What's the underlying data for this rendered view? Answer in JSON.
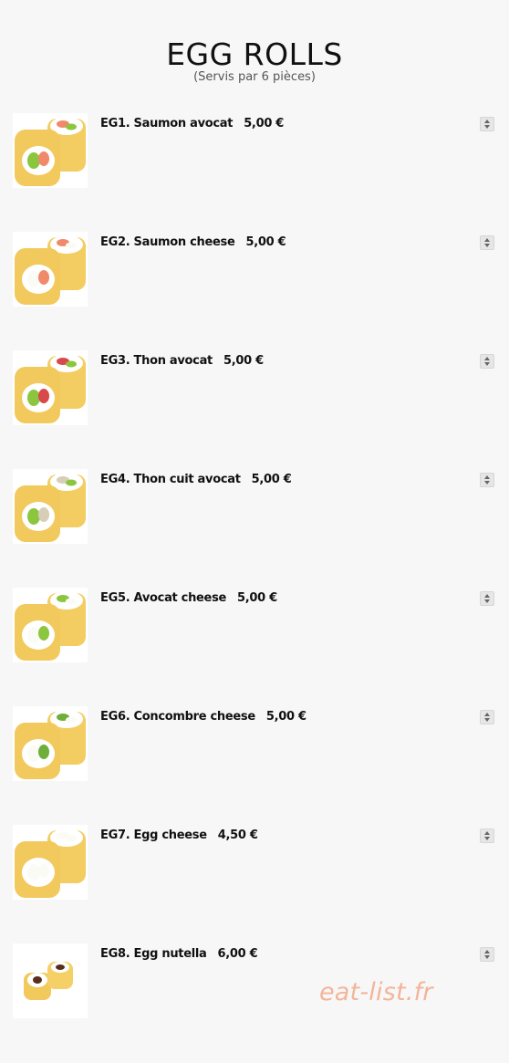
{
  "header": {
    "title": "EGG ROLLS",
    "subtitle": "(Servis par 6 pièces)"
  },
  "items": [
    {
      "label": "EG1. Saumon avocat",
      "price": "5,00 €",
      "filling": [
        "salmon",
        "avocado"
      ]
    },
    {
      "label": "EG2. Saumon cheese",
      "price": "5,00 €",
      "filling": [
        "salmon",
        "cheese"
      ]
    },
    {
      "label": "EG3. Thon avocat",
      "price": "5,00 €",
      "filling": [
        "tuna",
        "avocado"
      ]
    },
    {
      "label": "EG4. Thon cuit avocat",
      "price": "5,00 €",
      "filling": [
        "cooked-tuna",
        "avocado"
      ]
    },
    {
      "label": "EG5. Avocat cheese",
      "price": "5,00 €",
      "filling": [
        "avocado",
        "cheese"
      ]
    },
    {
      "label": "EG6. Concombre cheese",
      "price": "5,00 €",
      "filling": [
        "cucumber",
        "cheese"
      ]
    },
    {
      "label": "EG7. Egg cheese",
      "price": "4,50 €",
      "filling": [
        "cheese"
      ]
    },
    {
      "label": "EG8. Egg nutella",
      "price": "6,00 €",
      "filling": [
        "nutella"
      ]
    }
  ],
  "watermark": "eat-list.fr",
  "colors": {
    "background": "#f7f7f7",
    "egg": "#f2c95c",
    "watermark": "#f3b59a"
  }
}
